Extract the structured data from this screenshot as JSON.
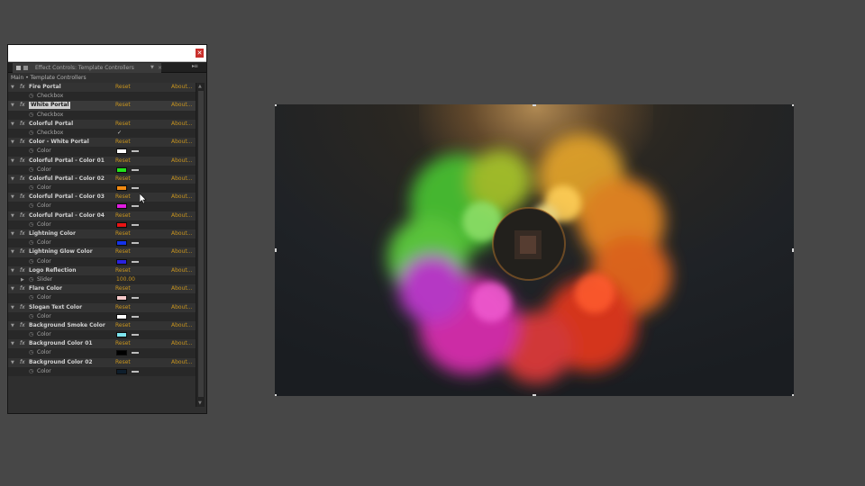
{
  "panel": {
    "tab_label": "Effect Controls: Template Controllers",
    "breadcrumb": "Main • Template Controllers",
    "reset_label": "Reset",
    "about_label": "About..."
  },
  "effects": [
    {
      "name": "Fire Portal",
      "prop": "Checkbox",
      "type": "checkbox",
      "checked": false
    },
    {
      "name": "White Portal",
      "prop": "Checkbox",
      "type": "checkbox",
      "checked": false,
      "selected": true
    },
    {
      "name": "Colorful Portal",
      "prop": "Checkbox",
      "type": "checkbox",
      "checked": true
    },
    {
      "name": "Color - White Portal",
      "prop": "Color",
      "type": "color",
      "color": "#ffffff"
    },
    {
      "name": "Colorful Portal - Color 01",
      "prop": "Color",
      "type": "color",
      "color": "#22e31b"
    },
    {
      "name": "Colorful Portal - Color 02",
      "prop": "Color",
      "type": "color",
      "color": "#f28a12"
    },
    {
      "name": "Colorful Portal - Color 03",
      "prop": "Color",
      "type": "color",
      "color": "#e01de0"
    },
    {
      "name": "Colorful Portal - Color 04",
      "prop": "Color",
      "type": "color",
      "color": "#e81414"
    },
    {
      "name": "Lightning Color",
      "prop": "Color",
      "type": "color",
      "color": "#1433e8"
    },
    {
      "name": "Lightning Glow Color",
      "prop": "Color",
      "type": "color",
      "color": "#2a22e0"
    },
    {
      "name": "Logo Reflection",
      "prop": "Slider",
      "type": "slider",
      "value": "100.00"
    },
    {
      "name": "Flare Color",
      "prop": "Color",
      "type": "color",
      "color": "#f6c9c9"
    },
    {
      "name": "Slogan Text Color",
      "prop": "Color",
      "type": "color",
      "color": "#ffffff"
    },
    {
      "name": "Background Smoke Color",
      "prop": "Color",
      "type": "color",
      "color": "#7de4ee"
    },
    {
      "name": "Background Color 01",
      "prop": "Color",
      "type": "color",
      "color": "#000000"
    },
    {
      "name": "Background Color 02",
      "prop": "Color",
      "type": "color",
      "color": "#0e1e2c"
    }
  ],
  "colors": {
    "link": "#c8941e",
    "panel_bg": "#2f2f2f",
    "app_bg": "#474747",
    "close_button": "#c9302c"
  },
  "icons": {
    "close": "close-icon",
    "fx": "fx-icon",
    "stopwatch": "stopwatch-icon",
    "twirl": "twirl-down-icon",
    "eyedropper": "eyedropper-icon"
  }
}
